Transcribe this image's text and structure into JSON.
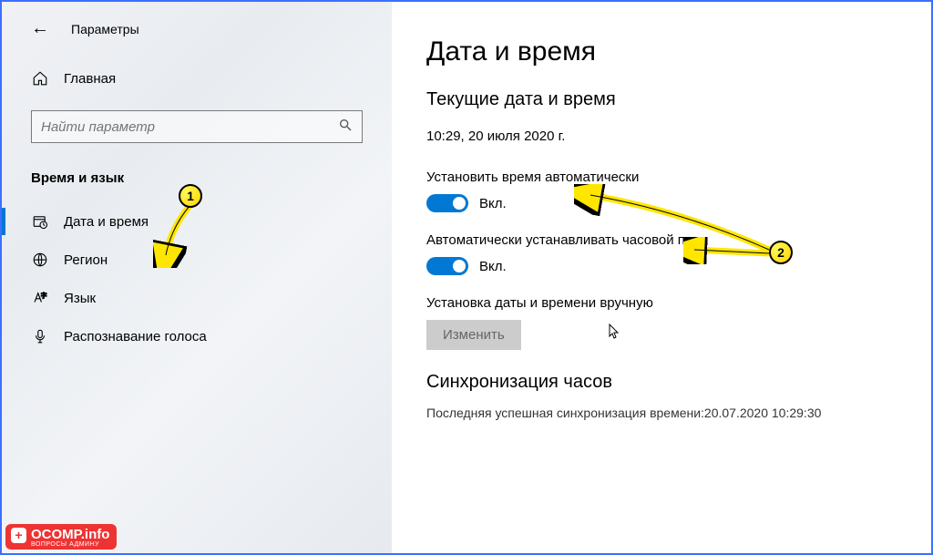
{
  "header": {
    "title": "Параметры"
  },
  "home": {
    "label": "Главная"
  },
  "search": {
    "placeholder": "Найти параметр"
  },
  "section": {
    "title": "Время и язык"
  },
  "nav": {
    "items": [
      {
        "label": "Дата и время"
      },
      {
        "label": "Регион"
      },
      {
        "label": "Язык"
      },
      {
        "label": "Распознавание голоса"
      }
    ]
  },
  "page": {
    "title": "Дата и время",
    "current_title": "Текущие дата и время",
    "current_value": "10:29, 20 июля 2020 г.",
    "auto_time_label": "Установить время автоматически",
    "auto_tz_label": "Автоматически устанавливать часовой пояс",
    "state_on": "Вкл.",
    "manual_label": "Установка даты и времени вручную",
    "change_button": "Изменить",
    "sync_title": "Синхронизация часов",
    "sync_line": "Последняя успешная синхронизация времени:20.07.2020 10:29:30"
  },
  "markers": {
    "one": "1",
    "two": "2"
  },
  "logo": {
    "text": "OCOMP.info",
    "sub": "ВОПРОСЫ АДМИНУ"
  }
}
